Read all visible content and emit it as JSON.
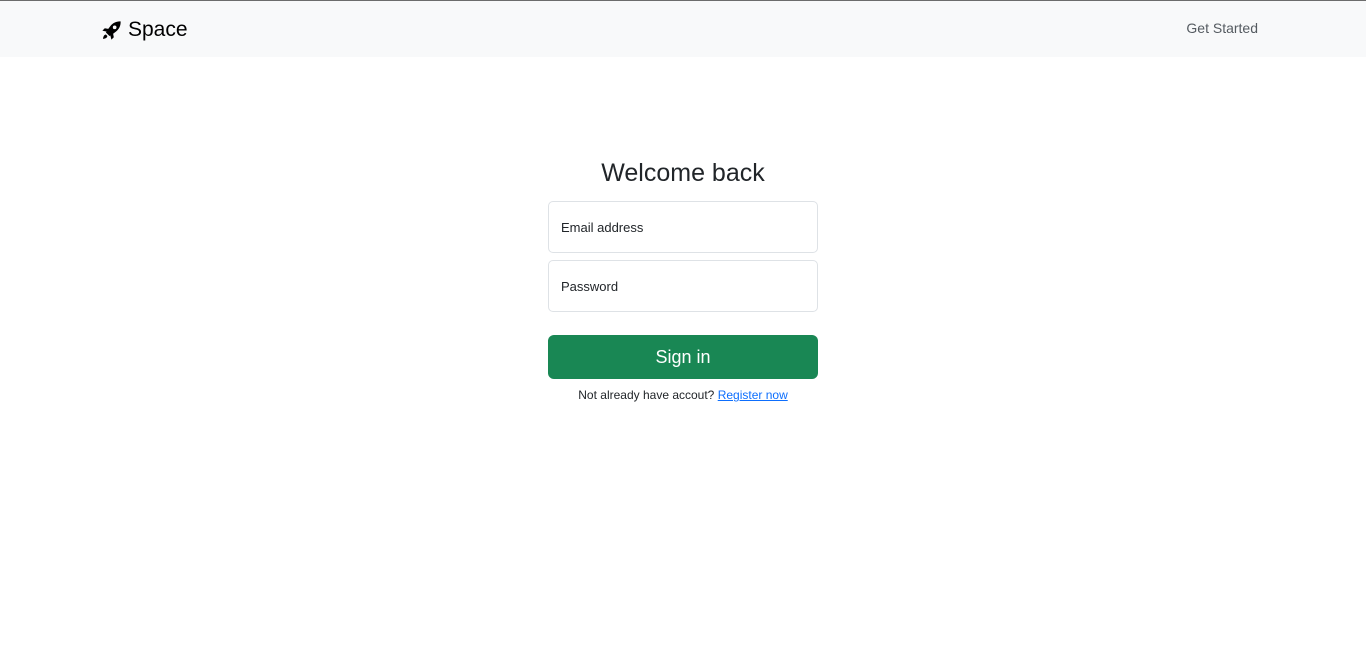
{
  "navbar": {
    "brand_icon": "rocket-icon",
    "brand_text": "Space",
    "get_started": "Get Started"
  },
  "login": {
    "title": "Welcome back",
    "email_placeholder": "Email address",
    "password_placeholder": "Password",
    "signin_label": "Sign in",
    "register_prompt": "Not already have accout?",
    "register_link": "Register now"
  },
  "colors": {
    "primary_button": "#198754",
    "link": "#0d6efd",
    "navbar_bg": "#f8f9fa"
  }
}
